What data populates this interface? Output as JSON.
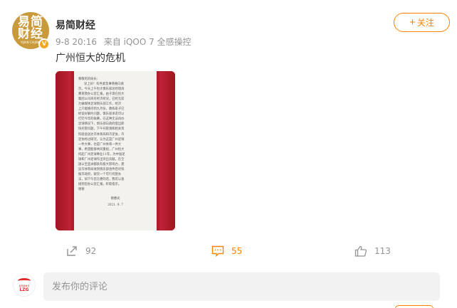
{
  "post": {
    "author": "易简财经",
    "avatar_text": {
      "line1": "易简",
      "line2": "财经",
      "line3": "YIJIAN CAIJING"
    },
    "verified_badge": "V",
    "meta": {
      "time": "9-8 20:16",
      "source": "来自 iQOO 7 全感操控"
    },
    "follow_label": "关注",
    "text": "广州恒大的危机",
    "image_letter": {
      "lines": [
        "尊敬的刘局长：",
        "早上好！有件紧急事情要向请",
        "示。今天上午恒大俱乐部总经理再",
        "熏来我办公室汇报，由于现在恒大",
        "集团公司再有经济状况，已经无前",
        "力做媒体足球俱乐部工作，经济",
        "上只能维持到九月份，教练班子已",
        "经谈好解约问题，俱乐部承诺可以",
        "打完今年的联赛，在这种无法再办",
        "足球情况下，俱乐部向政府提出即",
        "快托管问题，下午托管请和相关资",
        "料就会送达市体育局和市足协，市",
        "足协经过研究，认为这是广州足球",
        "一件大事，也是广州体育一件大",
        "事，希望能够共同重视，广州恒大",
        "托起广州足球事业11年，为中国足",
        "球和广州足球作出突出贡献，在全",
        "国以至亚洲都具有极大影响力，建",
        "议市体育局收到俱乐部函件后尽快",
        "报市政府，研究一个可行托管办",
        "法，如下午您方便的话，我可以直",
        "接到您办公室汇报，听取指示。",
        "    谢谢"
      ],
      "signature": "谢惠光",
      "date": "2021. 9. 7"
    }
  },
  "actions": {
    "share_count": "92",
    "comment_count": "55",
    "like_count": "113"
  },
  "comment_input": {
    "placeholder": "发布你的评论"
  },
  "commenter_avatar": {
    "tiny_text": "世界都体育",
    "label": "LZG"
  },
  "colors": {
    "accent": "#ff8200",
    "muted": "#939393",
    "image_bg": "#b51c2a",
    "avatar_bg": "#c99a3b"
  }
}
